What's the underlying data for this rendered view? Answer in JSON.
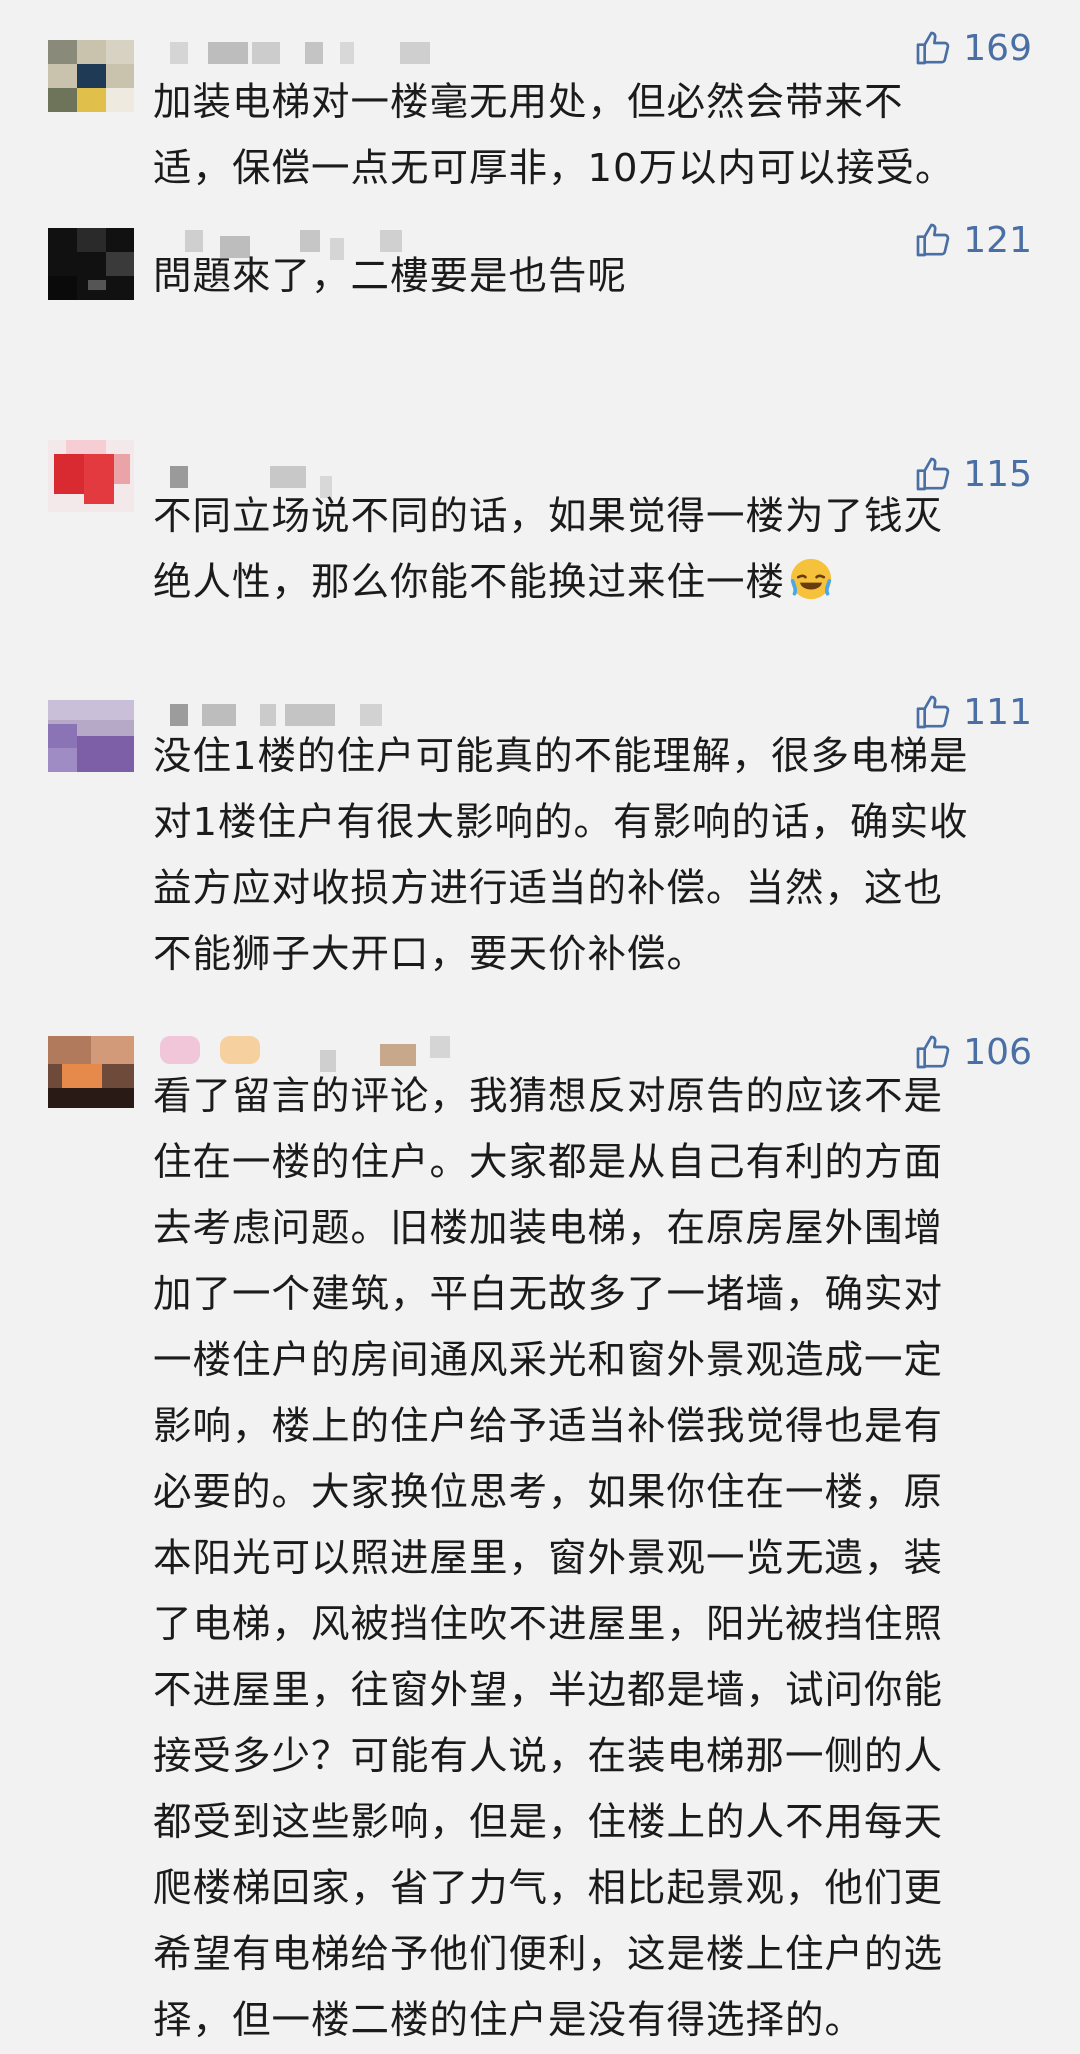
{
  "comments": [
    {
      "likes": "169",
      "text": "加装电梯对一楼毫无用处，但必然会带来不\n适，保偿一点无可厚非，10万以内可以接受。"
    },
    {
      "likes": "121",
      "text": "問題來了，二樓要是也告呢"
    },
    {
      "likes": "115",
      "text": "不同立场说不同的话，如果觉得一楼为了钱灭\n绝人性，那么你能不能换过来住一楼",
      "emoji": "laughing-crying-emoji"
    },
    {
      "likes": "111",
      "text": "没住1楼的住户可能真的不能理解，很多电梯是\n对1楼住户有很大影响的。有影响的话，确实收\n益方应对收损方进行适当的补偿。当然，这也\n不能狮子大开口，要天价补偿。"
    },
    {
      "likes": "106",
      "text": "看了留言的评论，我猜想反对原告的应该不是\n住在一楼的住户。大家都是从自己有利的方面\n去考虑问题。旧楼加装电梯，在原房屋外围增\n加了一个建筑，平白无故多了一堵墙，确实对\n一楼住户的房间通风采光和窗外景观造成一定\n影响，楼上的住户给予适当补偿我觉得也是有\n必要的。大家换位思考，如果你住在一楼，原\n本阳光可以照进屋里，窗外景观一览无遗，装\n了电梯，风被挡住吹不进屋里，阳光被挡住照\n不进屋里，往窗外望，半边都是墙，试问你能\n接受多少？可能有人说，在装电梯那一侧的人\n都受到这些影响，但是，住楼上的人不用每天\n爬楼梯回家，省了力气，相比起景观，他们更\n希望有电梯给予他们便利，这是楼上住户的选\n择，但一楼二楼的住户是没有得选择的。"
    }
  ],
  "colors": {
    "background": "#f2f2f2",
    "text": "#1b1b1b",
    "like": "#4a6fa5"
  },
  "icons": {
    "like": "thumbs-up-icon",
    "avatar": "pixelated-avatar",
    "username": "pixelated-username"
  }
}
